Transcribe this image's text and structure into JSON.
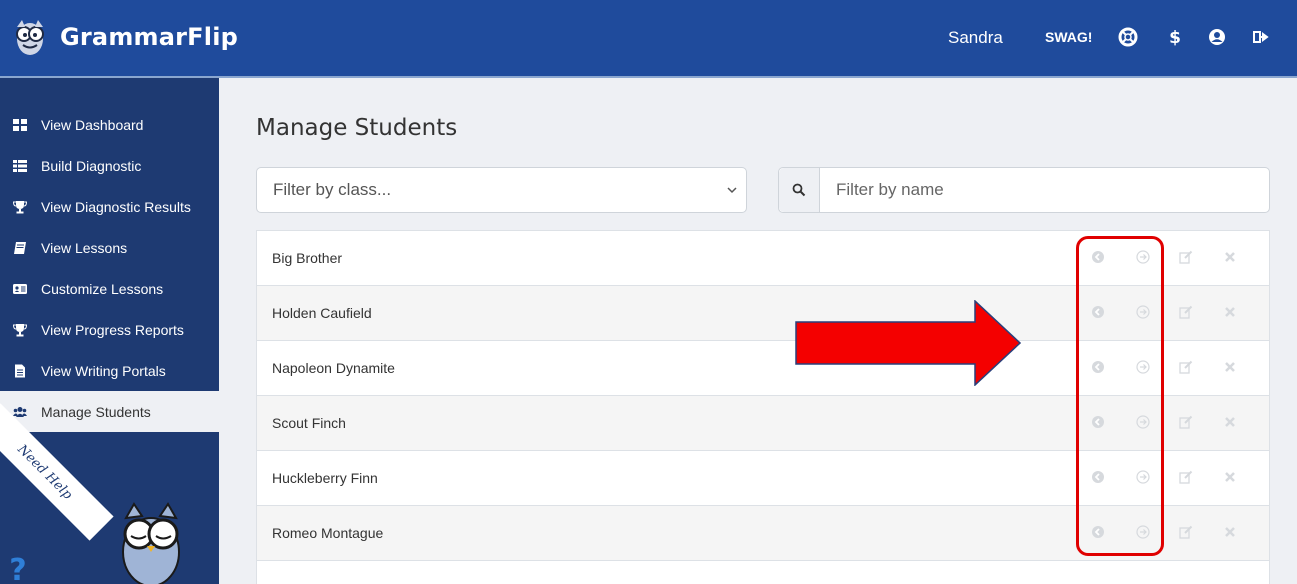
{
  "header": {
    "brand": "GrammarFlip",
    "user_name": "Sandra",
    "swag_label": "SWAG!",
    "icons": [
      "lifebuoy-icon",
      "dollar-icon",
      "user-circle-icon",
      "sign-out-icon"
    ]
  },
  "sidebar": {
    "items": [
      {
        "label": "View Dashboard",
        "icon": "dashboard-icon"
      },
      {
        "label": "Build Diagnostic",
        "icon": "list-icon"
      },
      {
        "label": "View Diagnostic Results",
        "icon": "trophy-icon"
      },
      {
        "label": "View Lessons",
        "icon": "book-icon"
      },
      {
        "label": "Customize Lessons",
        "icon": "id-card-icon"
      },
      {
        "label": "View Progress Reports",
        "icon": "trophy-icon"
      },
      {
        "label": "View Writing Portals",
        "icon": "file-icon"
      },
      {
        "label": "Manage Students",
        "icon": "users-icon",
        "active": true
      }
    ],
    "help_label": "Need Help"
  },
  "main": {
    "title": "Manage Students",
    "class_filter_placeholder": "Filter by class...",
    "name_filter_placeholder": "Filter by name",
    "students": [
      {
        "name": "Big Brother"
      },
      {
        "name": "Holden Caufield"
      },
      {
        "name": "Napoleon Dynamite"
      },
      {
        "name": "Scout Finch"
      },
      {
        "name": "Huckleberry Finn"
      },
      {
        "name": "Romeo Montague"
      }
    ],
    "row_actions": [
      "move-left-icon",
      "move-right-icon",
      "edit-icon",
      "delete-icon"
    ]
  },
  "colors": {
    "header_bg": "#1f4b9c",
    "sidebar_bg": "#1e3a72",
    "page_bg": "#eef0f4",
    "annotation": "#e00000"
  }
}
